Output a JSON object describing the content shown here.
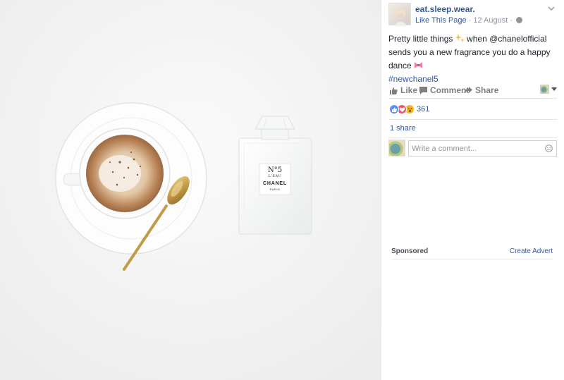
{
  "post": {
    "page_name": "eat.sleep.wear.",
    "like_page": "Like This Page",
    "separator": " · ",
    "date": "12 August",
    "text_1": "Pretty little things ",
    "text_2": " when @chanelofficial sends you a new fragrance you do a happy dance ",
    "hashtag": "#newchanel5"
  },
  "photo": {
    "bottle": {
      "line1": "N°5",
      "line2": "L'EAU",
      "brand": "CHANEL",
      "city": "PARIS"
    }
  },
  "actions": {
    "like": "Like",
    "comment": "Comment",
    "share": "Share"
  },
  "reactions": {
    "count": "361",
    "types": [
      "like",
      "love",
      "wow"
    ]
  },
  "shares": {
    "label": "1 share"
  },
  "comment": {
    "placeholder": "Write a comment..."
  },
  "sidebar": {
    "sponsored": "Sponsored",
    "create_advert": "Create Advert"
  },
  "icons": {
    "like": "thumbs-up-icon",
    "comment": "speech-bubble-icon",
    "share": "share-arrow-icon",
    "emoji_1": "sparkles-icon",
    "emoji_2": "ribbon-bow-icon"
  },
  "colors": {
    "link": "#365899",
    "muted": "#90949c",
    "like_reaction": "#5890ff",
    "love_reaction": "#f25268",
    "wow_reaction": "#f7b125"
  }
}
